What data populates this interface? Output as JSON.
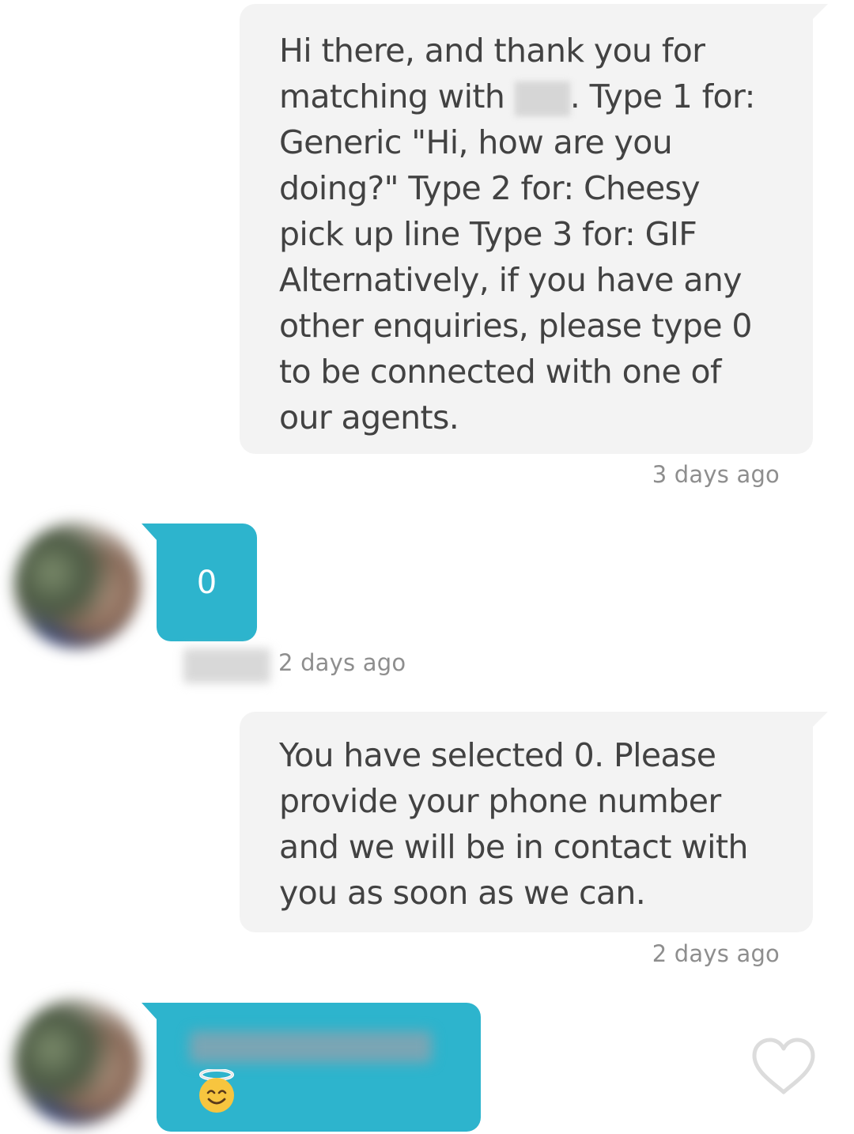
{
  "messages": [
    {
      "direction": "outgoing",
      "text_before_redaction": "Hi there, and thank you for matching with ",
      "text_after_redaction": ". Type 1 for: Generic \"Hi, how are you doing?\" Type 2 for: Cheesy pick up line Type 3 for: GIF Alternatively, if you have any other enquiries, please type 0 to be connected with one of our agents.",
      "timestamp": "3 days ago"
    },
    {
      "direction": "incoming",
      "text": "0",
      "timestamp": "2 days ago"
    },
    {
      "direction": "outgoing",
      "text": "You have selected 0. Please provide your phone number and we will be in contact with you as soon as we can.",
      "timestamp": "2 days ago"
    },
    {
      "direction": "incoming",
      "emoji": "😇",
      "emoji_icon": "smiling-face-with-halo-icon"
    }
  ],
  "colors": {
    "incoming_bubble": "#2db4cd",
    "outgoing_bubble": "#f3f3f3",
    "outgoing_text": "#424242",
    "timestamp": "#8e8e8e",
    "heart_outline": "#dcdcdc"
  },
  "icons": {
    "like": "heart-outline-icon"
  }
}
